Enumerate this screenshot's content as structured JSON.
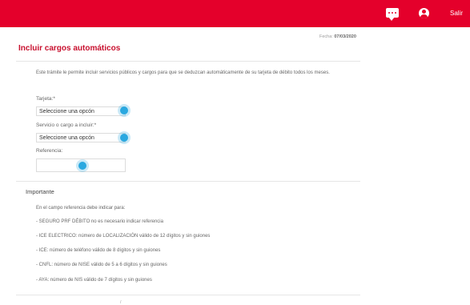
{
  "header": {
    "chat_icon": "chat-icon",
    "user_icon": "user-icon",
    "logout_label": "Salir",
    "color": "#e4002b"
  },
  "page": {
    "date_label": "Fecha:",
    "date_value": "07/03/2020",
    "title": "Incluir cargos automáticos",
    "description": "Este trámite le permite incluir servicios públicos y cargos para que se deduzcan automáticamente de su tarjeta de débito todos los meses."
  },
  "form": {
    "card_label": "Tarjeta:*",
    "card_value": "Seleccione una opcón",
    "service_label": "Servicio o cargo a incluir:*",
    "service_value": "Seleccione una opcón",
    "reference_label": "Referencia:",
    "reference_value": ""
  },
  "important": {
    "heading": "Importante",
    "intro": "En el campo referencia debe indicar para:",
    "items": [
      "- SEGURO PRF DÉBITO no es necesario indicar referencia",
      "- ICE ELECTRICO: número de LOCALIZACIÓN válido de 12 dígitos y sin guiones",
      "- ICE: número de teléfono válido de 8 dígitos y sin guiones",
      "- CNFL: número de NISE válido de 5 a 6 dígitos y sin guiones",
      "- AYA: número de NIS válido de 7 dígitos y sin guiones"
    ]
  },
  "footer": {
    "mark": "/"
  }
}
